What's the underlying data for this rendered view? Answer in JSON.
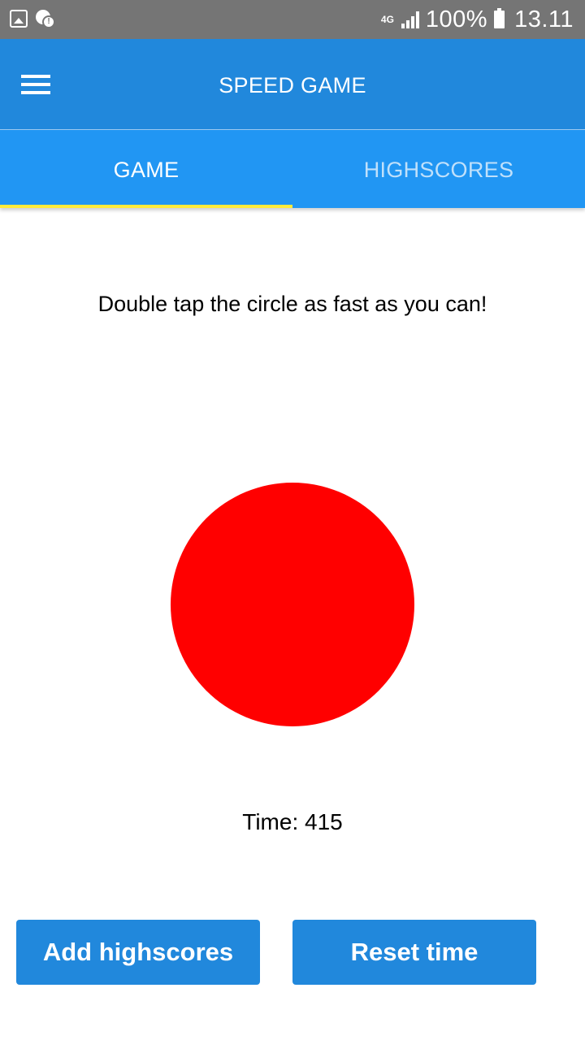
{
  "status_bar": {
    "icons": [
      "gallery-icon",
      "alert-icon"
    ],
    "network": "4G",
    "battery_text": "100%",
    "clock": "13.11"
  },
  "app_bar": {
    "title": "SPEED GAME",
    "menu_icon": "hamburger-menu-icon"
  },
  "tabs": [
    {
      "label": "GAME",
      "selected": true
    },
    {
      "label": "HIGHSCORES",
      "selected": false
    }
  ],
  "game": {
    "instruction": "Double tap the circle as fast as you can!",
    "circle_color": "#ff0000",
    "time_label": "Time:",
    "time_value": "415"
  },
  "buttons": {
    "add_highscores": "Add highscores",
    "reset_time": "Reset time"
  },
  "colors": {
    "status_bar": "#757575",
    "app_bar": "#2188dc",
    "tab_bar": "#2196f3",
    "tab_indicator": "#ffeb3b",
    "button": "#2188dc"
  }
}
